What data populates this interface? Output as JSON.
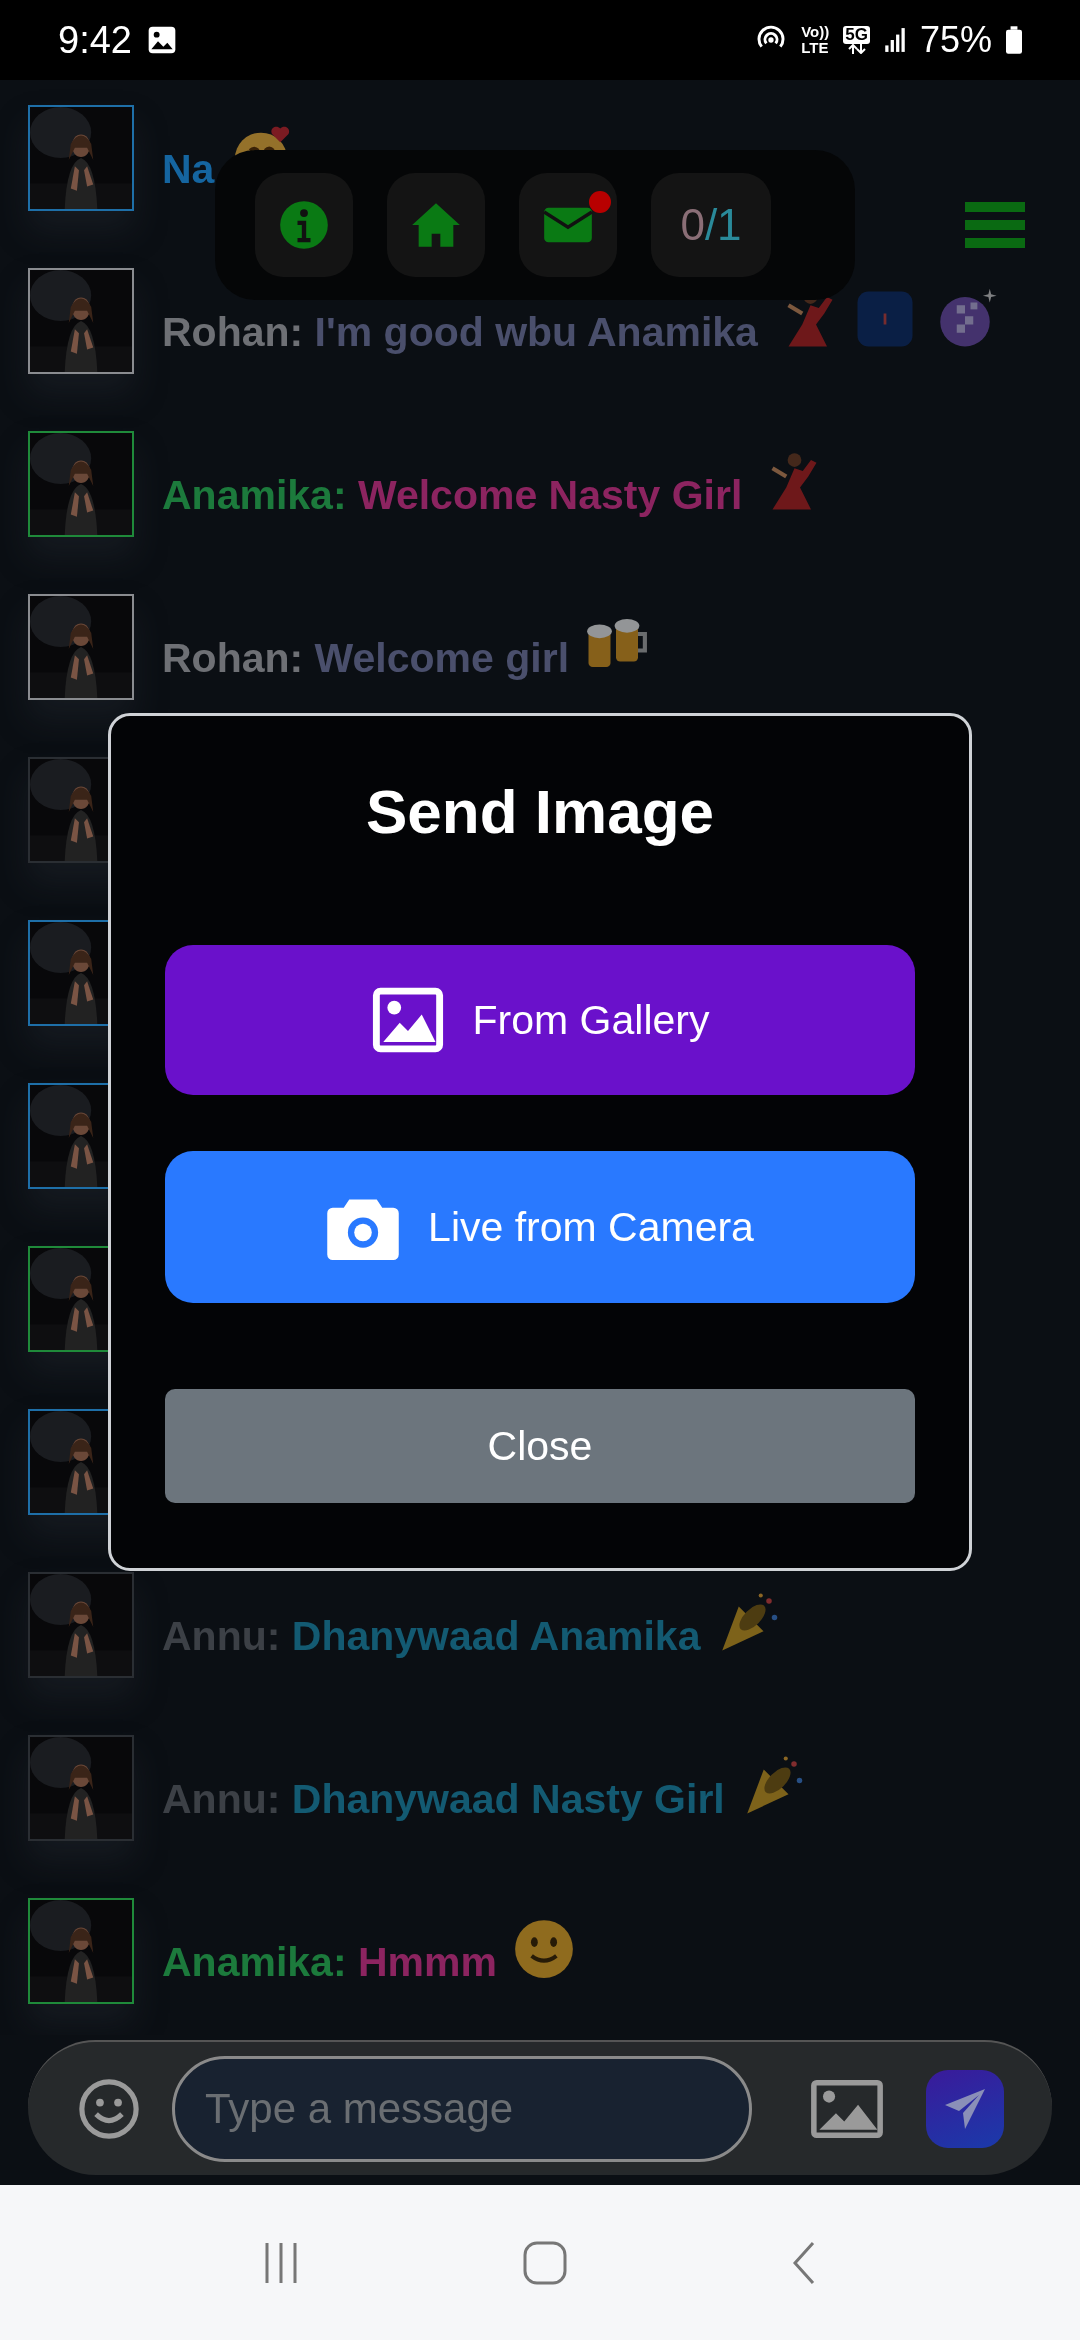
{
  "status_bar": {
    "time": "9:42",
    "volte_top": "Vo))",
    "volte_bottom": "LTE",
    "network": "5G",
    "battery": "75%"
  },
  "toolbar": {
    "buttons": [
      {
        "kind": "info"
      },
      {
        "kind": "home"
      },
      {
        "kind": "mail",
        "badge": true
      }
    ],
    "counter": {
      "value": "0",
      "total": "/1"
    }
  },
  "messages": [
    {
      "avatar": {
        "color": "#1e6fa8"
      },
      "sender": {
        "name": "Na",
        "color": "#1565a0"
      },
      "stickers": [
        {
          "kind": "hearts-face"
        }
      ]
    },
    {
      "avatar": {
        "color": "#8a8c90"
      },
      "sender": {
        "name": "Rohan:",
        "color": "#6e7075"
      },
      "text": {
        "value": "I'm good wbu Anamika",
        "color": "#4a4f6c"
      },
      "stickers": [
        {
          "kind": "dancer"
        },
        {
          "kind": "tile"
        },
        {
          "kind": "disco-ball"
        }
      ]
    },
    {
      "avatar": {
        "color": "#1f8a3a"
      },
      "sender": {
        "name": "Anamika:",
        "color": "#1c7a3c"
      },
      "text": {
        "value": "Welcome Nasty Girl",
        "color": "#8c2460"
      },
      "stickers": [
        {
          "kind": "dancer"
        }
      ]
    },
    {
      "avatar": {
        "color": "#8a8c90"
      },
      "sender": {
        "name": "Rohan:",
        "color": "#6e7075"
      },
      "text": {
        "value": "Welcome girl",
        "color": "#4a4f6c"
      },
      "stickers": [
        {
          "kind": "beers"
        }
      ]
    },
    {
      "avatar": {
        "color": "#2a2e33"
      }
    },
    {
      "avatar": {
        "color": "#1e6fa8"
      }
    },
    {
      "avatar": {
        "color": "#1e6fa8"
      }
    },
    {
      "avatar": {
        "color": "#1f8a3a"
      }
    },
    {
      "avatar": {
        "color": "#1e6fa8"
      }
    },
    {
      "avatar": {
        "color": "#2a2e33"
      },
      "sender": {
        "name": "Annu:",
        "color": "#3c4046"
      },
      "text": {
        "value": "Dhanywaad Anamika",
        "color": "#135a72"
      },
      "stickers": [
        {
          "kind": "party-popper"
        }
      ]
    },
    {
      "avatar": {
        "color": "#2a2e33"
      },
      "sender": {
        "name": "Annu:",
        "color": "#3c4046"
      },
      "text": {
        "value": "Dhanywaad Nasty Girl",
        "color": "#135a72"
      },
      "stickers": [
        {
          "kind": "party-popper"
        }
      ]
    },
    {
      "avatar": {
        "color": "#1f8a3a"
      },
      "sender": {
        "name": "Anamika:",
        "color": "#1c7a3c"
      },
      "text": {
        "value": "Hmmm",
        "color": "#8c2460"
      },
      "stickers": [
        {
          "kind": "smile"
        }
      ]
    }
  ],
  "dialog": {
    "title": "Send Image",
    "buttons": [
      {
        "kind": "gallery",
        "label": "From Gallery"
      },
      {
        "kind": "camera",
        "label": "Live from Camera"
      },
      {
        "kind": "close",
        "label": "Close"
      }
    ]
  },
  "composer": {
    "placeholder": "Type a message"
  }
}
